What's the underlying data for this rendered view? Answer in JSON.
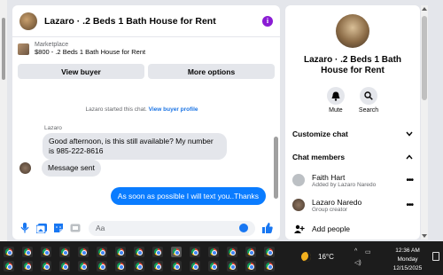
{
  "colors": {
    "accent": "#0a7cff",
    "link": "#1b74e4",
    "info_badge": "#8a1cd4",
    "taskbar": "#1c1c1c"
  },
  "chat": {
    "title": "Lazaro · .2 Beds 1 Bath House for Rent",
    "info_icon": "info-icon",
    "marketplace": {
      "label": "Marketplace",
      "item": "$800 - .2 Beds 1 Bath House for Rent"
    },
    "buttons": {
      "view_buyer": "View buyer",
      "more_options": "More options"
    },
    "system_text": "Lazaro started this chat.",
    "system_link": "View buyer profile",
    "sender_name": "Lazaro",
    "messages": [
      {
        "direction": "in",
        "text": "Good afternoon, is this still available? My number is 985-222-8616"
      },
      {
        "direction": "in",
        "text": "Message sent"
      },
      {
        "direction": "out",
        "text": "As soon as possible I will text you..Thanks"
      }
    ],
    "composer": {
      "placeholder": "Aa",
      "icons": [
        "microphone-icon",
        "photo-icon",
        "sticker-icon",
        "gif-icon",
        "emoji-icon",
        "like-icon"
      ]
    }
  },
  "details": {
    "title": "Lazaro · .2 Beds 1 Bath House for Rent",
    "actions": [
      {
        "label": "Mute",
        "icon": "bell-icon"
      },
      {
        "label": "Search",
        "icon": "search-icon"
      }
    ],
    "customize_label": "Customize chat",
    "members_label": "Chat members",
    "members": [
      {
        "name": "Faith Hart",
        "sub": "Added by Lazaro Naredo"
      },
      {
        "name": "Lazaro Naredo",
        "sub": "Group creator"
      }
    ],
    "add_people": "Add people"
  },
  "taskbar": {
    "app_icon": "chrome-icon",
    "weather": "16°C",
    "clock": {
      "time": "12:36 AM",
      "day": "Monday",
      "date": "12/15/2025"
    }
  }
}
